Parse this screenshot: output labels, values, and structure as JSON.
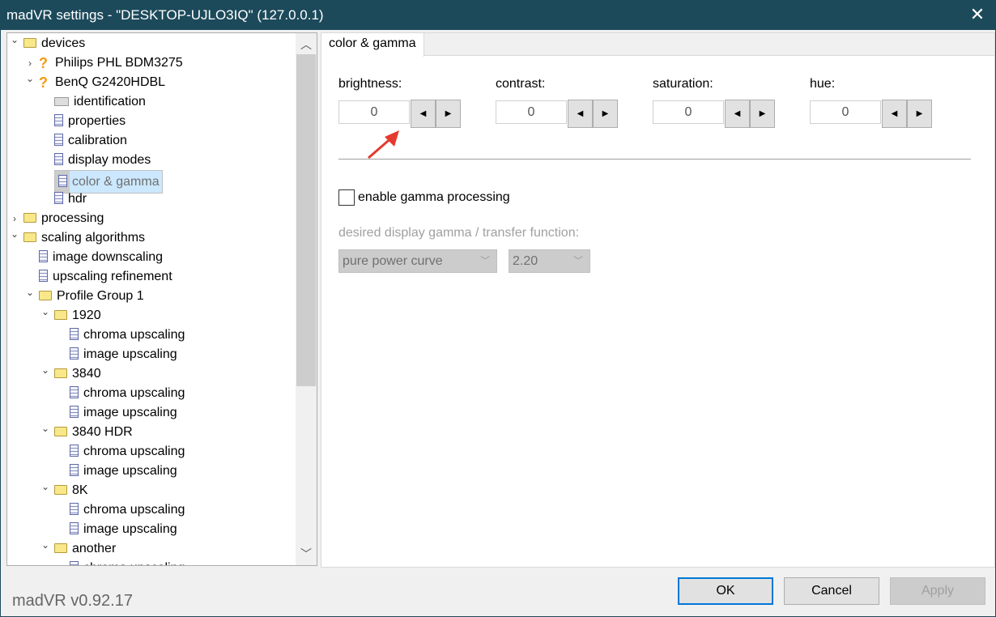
{
  "window": {
    "title": "madVR settings - \"DESKTOP-UJLO3IQ\" (127.0.0.1)",
    "close_icon": "close-icon"
  },
  "tree": {
    "items": [
      {
        "label": "devices",
        "level": 0,
        "icon": "folder",
        "exp": "open"
      },
      {
        "label": "Philips PHL BDM3275",
        "level": 1,
        "icon": "question",
        "exp": "closed"
      },
      {
        "label": "BenQ G2420HDBL",
        "level": 1,
        "icon": "question",
        "exp": "open"
      },
      {
        "label": "identification",
        "level": 2,
        "icon": "id-card",
        "exp": ""
      },
      {
        "label": "properties",
        "level": 2,
        "icon": "page",
        "exp": ""
      },
      {
        "label": "calibration",
        "level": 2,
        "icon": "page",
        "exp": ""
      },
      {
        "label": "display modes",
        "level": 2,
        "icon": "page",
        "exp": ""
      },
      {
        "label": "color & gamma",
        "level": 2,
        "icon": "page",
        "exp": "",
        "selected": true
      },
      {
        "label": "hdr",
        "level": 2,
        "icon": "page",
        "exp": ""
      },
      {
        "label": "processing",
        "level": 0,
        "icon": "folder",
        "exp": "closed"
      },
      {
        "label": "scaling algorithms",
        "level": 0,
        "icon": "folder",
        "exp": "open"
      },
      {
        "label": "image downscaling",
        "level": 1,
        "icon": "page",
        "exp": ""
      },
      {
        "label": "upscaling refinement",
        "level": 1,
        "icon": "page",
        "exp": ""
      },
      {
        "label": "Profile Group 1",
        "level": 1,
        "icon": "folder",
        "exp": "open"
      },
      {
        "label": "1920",
        "level": 2,
        "icon": "folder",
        "exp": "open"
      },
      {
        "label": "chroma upscaling",
        "level": 3,
        "icon": "page",
        "exp": ""
      },
      {
        "label": "image upscaling",
        "level": 3,
        "icon": "page",
        "exp": ""
      },
      {
        "label": "3840",
        "level": 2,
        "icon": "folder",
        "exp": "open"
      },
      {
        "label": "chroma upscaling",
        "level": 3,
        "icon": "page",
        "exp": ""
      },
      {
        "label": "image upscaling",
        "level": 3,
        "icon": "page",
        "exp": ""
      },
      {
        "label": "3840 HDR",
        "level": 2,
        "icon": "folder",
        "exp": "open"
      },
      {
        "label": "chroma upscaling",
        "level": 3,
        "icon": "page",
        "exp": ""
      },
      {
        "label": "image upscaling",
        "level": 3,
        "icon": "page",
        "exp": ""
      },
      {
        "label": "8K",
        "level": 2,
        "icon": "folder",
        "exp": "open"
      },
      {
        "label": "chroma upscaling",
        "level": 3,
        "icon": "page",
        "exp": ""
      },
      {
        "label": "image upscaling",
        "level": 3,
        "icon": "page",
        "exp": ""
      },
      {
        "label": "another",
        "level": 2,
        "icon": "folder",
        "exp": "open"
      },
      {
        "label": "chroma upscaling",
        "level": 3,
        "icon": "page",
        "exp": ""
      }
    ]
  },
  "panel": {
    "tab": "color & gamma",
    "spinners": [
      {
        "label": "brightness:",
        "value": "0"
      },
      {
        "label": "contrast:",
        "value": "0"
      },
      {
        "label": "saturation:",
        "value": "0"
      },
      {
        "label": "hue:",
        "value": "0"
      }
    ],
    "gamma_checkbox": {
      "label": "enable gamma processing",
      "checked": false
    },
    "gamma_label": "desired display gamma / transfer function:",
    "curve_select": "pure power curve",
    "gamma_select": "2.20",
    "annotation_color": "#e53a2f"
  },
  "footer": {
    "version": "madVR v0.92.17",
    "ok": "OK",
    "cancel": "Cancel",
    "apply": "Apply"
  }
}
